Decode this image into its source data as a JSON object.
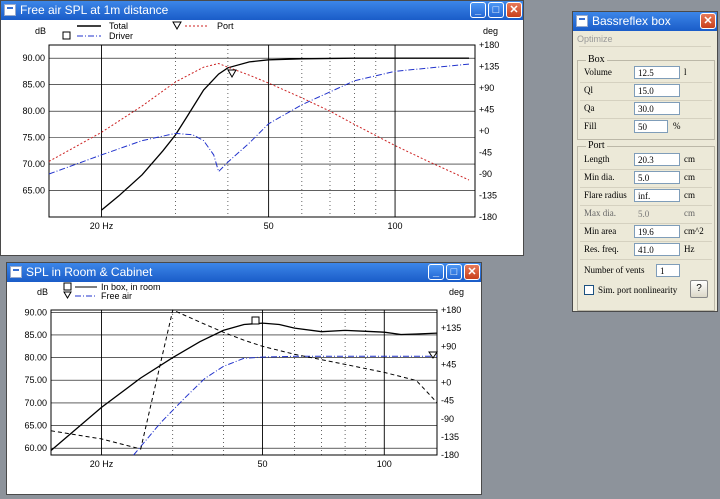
{
  "window1": {
    "title": "Free air SPL at 1m distance",
    "y_left_unit": "dB",
    "y_right_unit": "deg",
    "legend": [
      "Total",
      "Port",
      "Driver"
    ]
  },
  "window2": {
    "title": "SPL in Room & Cabinet",
    "y_left_unit": "dB",
    "y_right_unit": "deg",
    "legend": [
      "In box, in room",
      "Free air"
    ]
  },
  "window3": {
    "title": "Bassreflex box",
    "menu": "Optimize",
    "box": {
      "group_label": "Box",
      "volume_label": "Volume",
      "volume_value": "12.5",
      "volume_unit": "l",
      "ql_label": "Ql",
      "ql_value": "15.0",
      "qa_label": "Qa",
      "qa_value": "30.0",
      "fill_label": "Fill",
      "fill_value": "50",
      "fill_unit": "%"
    },
    "port": {
      "group_label": "Port",
      "length_label": "Length",
      "length_value": "20.3",
      "length_unit": "cm",
      "min_dia_label": "Min dia.",
      "min_dia_value": "5.0",
      "min_dia_unit": "cm",
      "flare_label": "Flare radius",
      "flare_value": "inf.",
      "flare_unit": "cm",
      "max_dia_label": "Max dia.",
      "max_dia_value": "5.0",
      "max_dia_unit": "cm",
      "min_area_label": "Min area",
      "min_area_value": "19.6",
      "min_area_unit": "cm^2",
      "res_freq_label": "Res. freq.",
      "res_freq_value": "41.0",
      "res_freq_unit": "Hz",
      "vents_label": "Number of vents",
      "vents_value": "1",
      "sim_label": "Sim. port nonlinearity",
      "help_label": "?"
    }
  },
  "chart_data": [
    {
      "type": "line",
      "x_scale": "log",
      "xlim": [
        15,
        155
      ],
      "ylim": [
        60,
        92.5
      ],
      "y2lim": [
        -180,
        180
      ],
      "y_ticks": [
        "90.00",
        "85.00",
        "80.00",
        "75.00",
        "70.00",
        "65.00"
      ],
      "y2_ticks": [
        "+180",
        "+135",
        "+90",
        "+45",
        "+0",
        "-45",
        "-90",
        "-135",
        "-180"
      ],
      "x_ticks": [
        "20 Hz",
        "50",
        "100"
      ],
      "series": [
        {
          "name": "Total",
          "axis": "left",
          "style": "solid",
          "color": "#000000",
          "x": [
            20,
            22,
            25,
            28,
            30,
            32,
            35,
            38,
            40,
            45,
            50,
            60,
            80,
            100,
            130,
            150
          ],
          "y": [
            61.3,
            64.0,
            68.0,
            72.5,
            75.5,
            79.0,
            84.0,
            87.0,
            88.2,
            89.3,
            89.7,
            89.9,
            90.0,
            90.0,
            90.0,
            90.0
          ]
        },
        {
          "name": "Port",
          "axis": "left",
          "style": "dotted",
          "color": "#cc2222",
          "x": [
            15,
            20,
            25,
            30,
            35,
            38,
            40,
            45,
            50,
            60,
            70,
            80,
            100,
            120,
            150
          ],
          "y": [
            70.5,
            76.0,
            81.0,
            85.5,
            88.3,
            89.0,
            88.3,
            86.8,
            85.3,
            82.5,
            80.0,
            77.5,
            73.5,
            70.5,
            67.0
          ]
        },
        {
          "name": "Driver",
          "axis": "right",
          "style": "dashdot",
          "color": "#2233cc",
          "x": [
            15,
            20,
            25,
            30,
            33,
            35,
            37,
            38,
            40,
            45,
            50,
            60,
            80,
            100,
            150
          ],
          "y": [
            -90,
            -50,
            -20,
            -5,
            -8,
            -20,
            -50,
            -85,
            -65,
            -25,
            15,
            55,
            105,
            125,
            140
          ]
        }
      ]
    },
    {
      "type": "line",
      "x_scale": "log",
      "xlim": [
        15,
        135
      ],
      "ylim": [
        58.5,
        90.5
      ],
      "y2lim": [
        -180,
        180
      ],
      "y_ticks": [
        "90.00",
        "85.00",
        "80.00",
        "75.00",
        "70.00",
        "65.00",
        "60.00"
      ],
      "y2_ticks": [
        "+180",
        "+135",
        "+90",
        "+45",
        "+0",
        "-45",
        "-90",
        "-135",
        "-180"
      ],
      "x_ticks": [
        "20 Hz",
        "50",
        "100"
      ],
      "series": [
        {
          "name": "In box, in room",
          "axis": "left",
          "style": "solid",
          "color": "#000000",
          "x": [
            15,
            20,
            25,
            30,
            35,
            40,
            45,
            50,
            55,
            60,
            70,
            80,
            90,
            100,
            110,
            120,
            135
          ],
          "y": [
            59.5,
            69.0,
            75.5,
            80.0,
            83.5,
            86.0,
            87.3,
            87.6,
            87.3,
            86.5,
            85.7,
            86.0,
            85.8,
            85.6,
            85.1,
            85.2,
            85.4
          ]
        },
        {
          "name": "Free air",
          "axis": "right",
          "style": "dashdot",
          "color": "#2233cc",
          "x": [
            24,
            28,
            32,
            36,
            40,
            45,
            50,
            60,
            80,
            100,
            135
          ],
          "y": [
            -180,
            -100,
            -40,
            10,
            40,
            60,
            63,
            65,
            65,
            65,
            65
          ]
        },
        {
          "name": "",
          "axis": "right",
          "style": "dashed",
          "color": "#000000",
          "x": [
            15,
            20,
            25,
            30,
            35,
            40,
            45,
            50,
            60,
            80,
            100,
            120,
            135
          ],
          "y": [
            -120,
            -140,
            -165,
            180,
            150,
            125,
            105,
            90,
            70,
            45,
            25,
            5,
            -50
          ]
        }
      ]
    }
  ]
}
